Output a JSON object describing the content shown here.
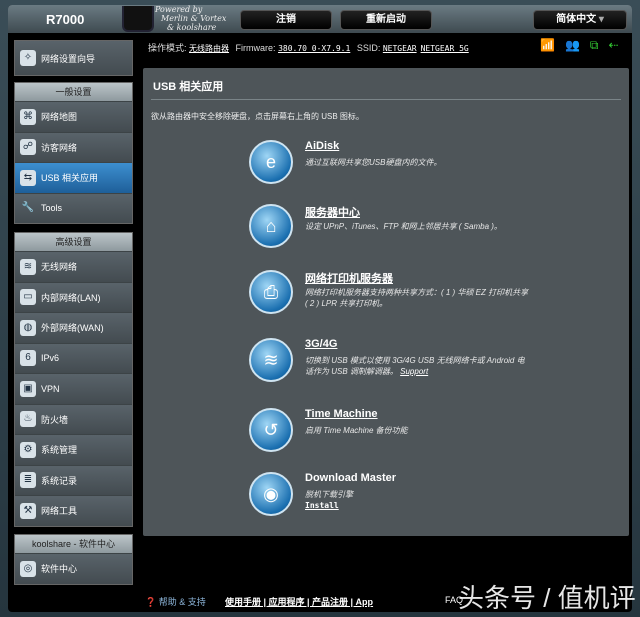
{
  "header": {
    "model": "R7000",
    "powered": [
      "Powered by",
      "Merlin & Vortex",
      "& koolshare"
    ],
    "logout": "注销",
    "reboot": "重新启动",
    "language": "简体中文"
  },
  "status": {
    "mode_label": "操作模式:",
    "mode": "无线路由器",
    "fw_label": "Firmware:",
    "fw": "380.70_0-X7.9.1",
    "ssid_label": "SSID:",
    "ssid1": "NETGEAR",
    "ssid2": "NETGEAR_5G"
  },
  "sidebar": {
    "wizard": "网络设置向导",
    "general_head": "一般设置",
    "general": [
      "网络地图",
      "访客网络",
      "USB 相关应用",
      "Tools"
    ],
    "adv_head": "高级设置",
    "advanced": [
      "无线网络",
      "内部网络(LAN)",
      "外部网络(WAN)",
      "IPv6",
      "VPN",
      "防火墙",
      "系统管理",
      "系统记录",
      "网络工具"
    ],
    "kool_head": "koolshare - 软件中心",
    "kool": [
      "软件中心"
    ]
  },
  "content": {
    "title": "USB 相关应用",
    "desc": "欲从路由器中安全移除硬盘，点击屏幕右上角的 USB 图标。",
    "apps": [
      {
        "title": "AiDisk",
        "desc": "通过互联网共享您USB硬盘内的文件。"
      },
      {
        "title": "服务器中心",
        "desc": "设定 UPnP、iTunes、FTP 和网上邻居共享 ( Samba )。"
      },
      {
        "title": "网络打印机服务器",
        "desc": "网络打印机服务器支持两种共享方式：( 1 ) 华硕 EZ 打印机共享 ( 2 ) LPR 共享打印机。"
      },
      {
        "title": "3G/4G",
        "desc": "切换到 USB 模式以使用 3G/4G USB 无线网络卡或 Android 电话作为 USB 调制解调器。",
        "link": "Support"
      },
      {
        "title": "Time Machine",
        "desc": "启用 Time Machine 备份功能"
      },
      {
        "title": "Download Master",
        "desc": "脱机下载引擎",
        "link": "Install"
      }
    ]
  },
  "footer": {
    "help": "帮助 & 支持",
    "links": "使用手册 | 应用程序 | 产品注册 | App",
    "faq": "FAQ"
  },
  "watermark": "头条号 / 值机评"
}
